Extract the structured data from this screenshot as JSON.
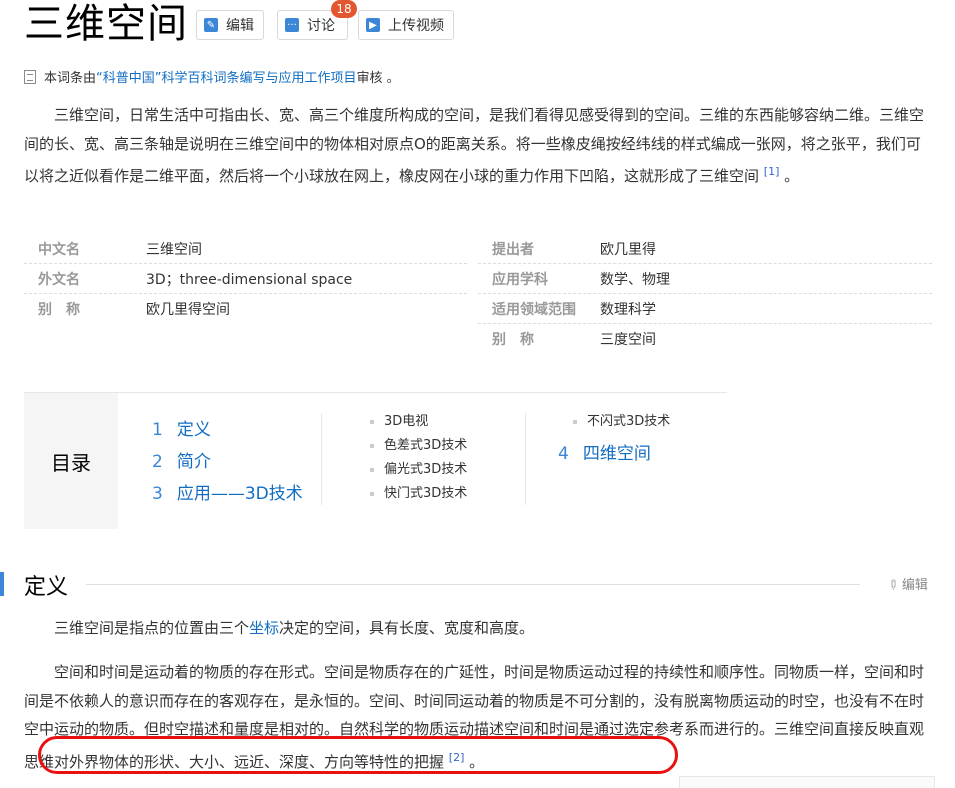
{
  "page": {
    "title": "三维空间"
  },
  "toolbar": {
    "edit_label": "编辑",
    "discuss_label": "讨论",
    "discuss_count": "18",
    "upload_label": "上传视频"
  },
  "review": {
    "prefix": "本词条由",
    "link": "“科普中国”科学百科词条编写与应用工作项目",
    "suffix": " 审核 。"
  },
  "summary": {
    "text": "三维空间，日常生活中可指由长、宽、高三个维度所构成的空间，是我们看得见感受得到的空间。三维的东西能够容纳二维。三维空间的长、宽、高三条轴是说明在三维空间中的物体相对原点O的距离关系。将一些橡皮绳按经纬线的样式编成一张网，将之张平，我们可以将之近似看作是二维平面，然后将一个小球放在网上，橡皮网在小球的重力作用下凹陷，这就形成了三维空间",
    "ref": "[1]",
    "end": " 。"
  },
  "infobox": {
    "left": [
      {
        "k": "中文名",
        "v": "三维空间"
      },
      {
        "k": "外文名",
        "v": "3D；three-dimensional space"
      },
      {
        "k": "别　称",
        "v": "欧几里得空间"
      }
    ],
    "right": [
      {
        "k": "提出者",
        "v": "欧几里得"
      },
      {
        "k": "应用学科",
        "v": "数学、物理"
      },
      {
        "k": "适用领域范围",
        "v": "数理科学"
      },
      {
        "k": "别　称",
        "v": "三度空间"
      }
    ]
  },
  "toc": {
    "header": "目录",
    "items": [
      {
        "n": "1",
        "label": "定义"
      },
      {
        "n": "2",
        "label": "简介"
      },
      {
        "n": "3",
        "label": "应用——3D技术"
      },
      {
        "n": "4",
        "label": "四维空间"
      }
    ],
    "subitems": [
      "3D电视",
      "色差式3D技术",
      "偏光式3D技术",
      "快门式3D技术",
      "不闪式3D技术"
    ]
  },
  "section": {
    "title": "定义",
    "edit_label": "编辑",
    "p1_before": "三维空间是指点的位置由三个",
    "p1_link": "坐标",
    "p1_after": "决定的空间，具有长度、宽度和高度。",
    "p2_text": "空间和时间是运动着的物质的存在形式。空间是物质存在的广延性，时间是物质运动过程的持续性和顺序性。同物质一样，空间和时间是不依赖人的意识而存在的客观存在，是永恒的。空间、时间同运动着的物质是不可分割的，没有脱离物质运动的时空，也没有不在时空中运动的物质。但时空描述和量度是相对的。自然科学的物质运动描述空间和时间是通过选定参考系而进行的。三维空间直接反映直观思维对外界物体的形状、大小、远近、深度、方向等特性的把握",
    "p2_ref": "[2]",
    "p2_end": " 。"
  },
  "colors": {
    "link": "#136ec2",
    "accent": "#3b86d6",
    "badge": "#e2572f",
    "highlight": "#e81010"
  }
}
